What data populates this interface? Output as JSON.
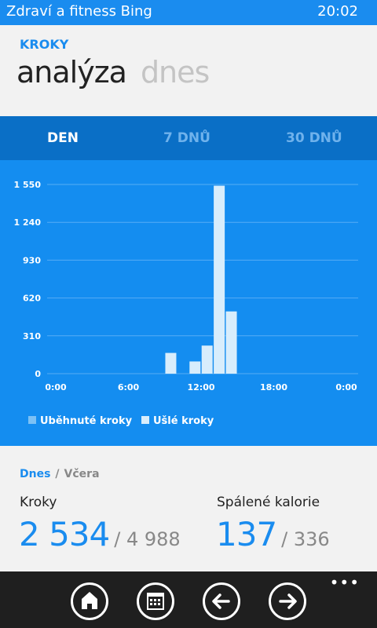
{
  "status_bar": {
    "app_name": "Zdraví a fitness Bing",
    "time": "20:02"
  },
  "header": {
    "section": "KROKY",
    "pivots": [
      "analýza",
      "dnes"
    ]
  },
  "period_tabs": [
    {
      "label": "DEN",
      "active": true
    },
    {
      "label": "7 DNŮ",
      "active": false
    },
    {
      "label": "30 DNŮ",
      "active": false
    }
  ],
  "chart_data": {
    "type": "bar",
    "ylim": [
      0,
      1550
    ],
    "y_ticks": [
      "0",
      "310",
      "620",
      "930",
      "1 240",
      "1 550"
    ],
    "x_ticks": [
      "0:00",
      "6:00",
      "12:00",
      "18:00",
      "0:00"
    ],
    "x_range_hours": [
      0,
      24
    ],
    "series": [
      {
        "name": "Uběhnuté kroky",
        "color": "#7cc1f5",
        "values": []
      },
      {
        "name": "Ušlé kroky",
        "color": "#d8edfc",
        "values": [
          {
            "hour": 9,
            "steps": 170
          },
          {
            "hour": 11,
            "steps": 100
          },
          {
            "hour": 12,
            "steps": 230
          },
          {
            "hour": 13,
            "steps": 1540
          },
          {
            "hour": 14,
            "steps": 510
          }
        ]
      }
    ],
    "grid": true,
    "legend_position": "bottom-left"
  },
  "stats": {
    "today": "Dnes",
    "separator": "/",
    "yesterday": "Včera",
    "steps_label": "Kroky",
    "steps_value": "2 534",
    "steps_goal": "/ 4 988",
    "calories_label": "Spálené kalorie",
    "calories_value": "137",
    "calories_goal": "/ 336"
  },
  "app_bar": {
    "buttons": [
      "home-icon",
      "calendar-icon",
      "back-arrow-icon",
      "forward-arrow-icon"
    ],
    "more": "•••"
  }
}
